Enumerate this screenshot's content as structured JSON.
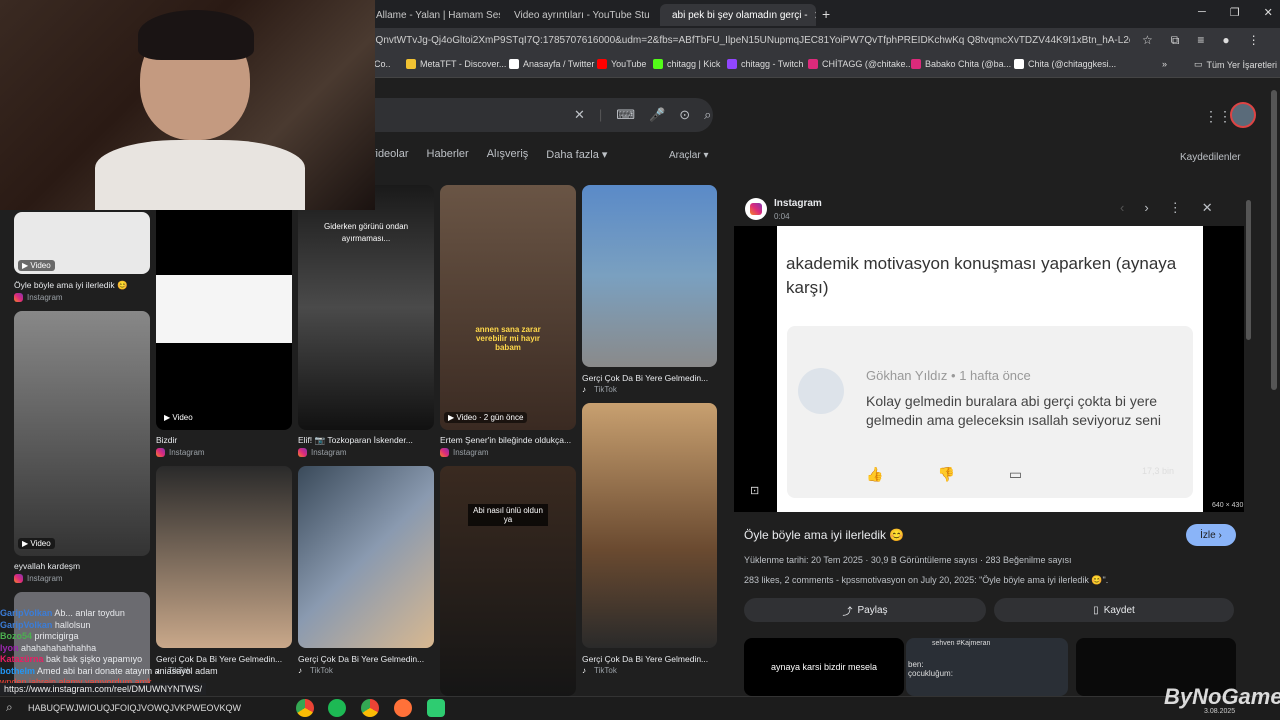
{
  "tabs": [
    {
      "label": "Allame - Yalan | Hamam Ses",
      "close": "✕"
    },
    {
      "label": "Video ayrıntıları - YouTube Stu",
      "close": "✕"
    },
    {
      "label": "abi pek bi şey olamadın gerçi -",
      "close": "✕"
    }
  ],
  "new_tab": "+",
  "url": "eQnvtWTvJg-Qj4oGltoi2XmP9STqI7Q:1785707616000&udm=2&fbs=ABfTbFU_IlpeN15UNupmqJEC81YoiPW7QvTfphPREIDKchwKq Q8tvqmcXvTDZV44K9I1xBtn_hA-L2cfJeejxbFMdAgc...",
  "bookmarks": [
    {
      "label": "Co..",
      "color": "#e06666"
    },
    {
      "label": "MetaTFT - Discover...",
      "color": "#f1c232"
    },
    {
      "label": "Anasayfa / Twitter",
      "color": "#ffffff"
    },
    {
      "label": "YouTube",
      "color": "#ff0000"
    },
    {
      "label": "chitagg | Kick",
      "color": "#53fc18"
    },
    {
      "label": "chitagg - Twitch",
      "color": "#9146ff"
    },
    {
      "label": "CHİTAGG (@chitake...",
      "color": "#dd2a7b"
    },
    {
      "label": "Babako Chita (@ba...",
      "color": "#dd2a7b"
    },
    {
      "label": "Chita (@chitaggkesi...",
      "color": "#ffffff"
    }
  ],
  "bookmarks_more": "»",
  "all_bookmarks": "Tüm Yer İşaretleri",
  "nav": [
    "videolar",
    "Haberler",
    "Alışveriş",
    "Daha fazla ▾"
  ],
  "tools": "Araçlar ▾",
  "saved": "Kaydedilenler",
  "results": [
    {
      "caption": "Öyle böyle ama iyi ilerledik 😊",
      "source": "Instagram",
      "badge": "▶ Video"
    },
    {
      "caption": "eyvallah kardeşm",
      "source": "Instagram",
      "badge": "▶ Video"
    },
    {
      "caption": "Bizdir",
      "source": "Instagram",
      "badge": "▶ Video"
    },
    {
      "caption": "Elif! 📷 Tozkoparan İskender...",
      "source": "Instagram",
      "overlay": "Giderken görünü ondan ayırmaması..."
    },
    {
      "caption": "Ertem Şener'in bileğinde oldukça...",
      "source": "Instagram",
      "badge": "▶ Video · 2 gün önce",
      "overlay": "annen sana zarar verebilir mi hayır babam"
    },
    {
      "caption": "Gerçi Çok Da Bi Yere Gelmedin...",
      "source": "TikTok"
    },
    {
      "caption": "Gerçi Çok Da Bi Yere Gelmedin...",
      "source": "TikTok"
    },
    {
      "caption": "Gerçi Çok Da Bi Yere Gelmedin...",
      "source": "TikTok"
    },
    {
      "caption": "Gerçi Çok Da Bi Yere Gelmedin...",
      "source": "TikTok"
    },
    {
      "caption": "Abi nasıl ünlü oldun ya",
      "source": ""
    }
  ],
  "panel": {
    "source": "Instagram",
    "time": "0:04",
    "shot_text": "akademik motivasyon konuşması yaparken (aynaya karşı)",
    "comment_author": "Gökhan Yıldız • 1 hafta önce",
    "comment_body": "Kolay gelmedin buralara abi gerçi çokta bi yere gelmedin ama geleceksin ısallah seviyoruz seni",
    "likes_faint": "17,3 bin",
    "size": "640 × 430",
    "title": "Öyle böyle ama iyi ilerledik 😊",
    "watch": "İzle ›",
    "meta1": "Yüklenme tarihi: 20 Tem 2025 · 30,9 B Görüntüleme sayısı · 283 Beğenilme sayısı",
    "meta2": "283 likes, 2 comments - kpssmotivasyon on July 20, 2025: \"Öyle böyle ama iyi ilerledik 😊\".",
    "share": "Paylaş",
    "save": "Kaydet",
    "related1": "aynaya karsi bizdir mesela",
    "related2_user": "sehven #Kajmeran",
    "related2_text": "ben: çocukluğum:"
  },
  "chat": [
    {
      "user": "GaripVolkan",
      "text": "Ab... anlar toydun",
      "color": "#3b7dd8"
    },
    {
      "user": "GaripVolkan",
      "text": "hallolsun",
      "color": "#3b7dd8"
    },
    {
      "user": "Bozo54",
      "text": "primcigirga",
      "color": "#4caf50"
    },
    {
      "user": "lyon",
      "text": "ahahahahahhahha",
      "color": "#9c27b0"
    },
    {
      "user": "Katazürna",
      "text": "bak bak şişko yapamıyo",
      "color": "#e91e63"
    },
    {
      "user": "bothelm",
      "text": "Amed abi bari donate atayım aniasayol adam",
      "color": "#2196f3"
    },
    {
      "user": "",
      "text": "wpden jahrein alamy yapıyordum amk",
      "color": "#f44336"
    }
  ],
  "status_url": "https://www.instagram.com/reel/DMUWNYNTWS/",
  "taskbar_text": "HABUQFWJWIOUQJFOIQJVOWQJVKPWEOVKQW",
  "watermark": "ByNoGame",
  "clock": "3.08.2025"
}
